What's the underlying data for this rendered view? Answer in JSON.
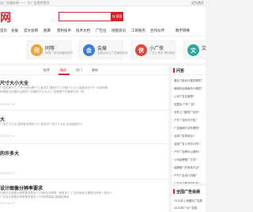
{
  "topbar": {
    "left_text": "告广告服务网 —— 为广告提供策划",
    "right_text": "设为首页"
  },
  "header": {
    "logo_text": "网",
    "search_button_label": "搜索"
  },
  "nav": {
    "items": [
      "首页",
      "会展",
      "官文会网",
      "图库",
      "营利技术",
      "技术文档",
      "广告位",
      "地图资讯",
      "工商税务",
      "合作伙伴",
      "数字转换"
    ]
  },
  "banner": {
    "cards": [
      {
        "icon": "同",
        "title": "同等",
        "sub": "网络广告与传播的热烈",
        "color": "#e9a33a"
      },
      {
        "icon": "会",
        "title": "会展",
        "sub": "会展活动与广告营销实践",
        "color": "#3a7bd5"
      },
      {
        "icon": "侠",
        "title": "小广侠",
        "sub": "广告小帮手 帮你搞定",
        "color": "#e0443a"
      },
      {
        "icon": "文",
        "title": "文",
        "sub": "",
        "color": "#2fa6a0"
      }
    ]
  },
  "tabs": [
    "推荐",
    "精选",
    "热门",
    "最新"
  ],
  "articles": [
    {
      "title": "尺寸大小大全",
      "desc": "广告标牌尺寸,户外大型标牌尺寸,宣传栏,展板尺寸,灯箱尺寸大小,画面设计尺寸,标准规格",
      "desc2": "标牌展示的展示出现的广告牌的尺寸大小,广告牌是户外最常见的一种",
      "meta": "2024-04-16"
    },
    {
      "title": "大",
      "desc": "广告尺寸大全,各种宣传物料尺寸,常见的广告尺寸大全,包括画面尺寸",
      "desc2": "",
      "meta": "2024-04-15"
    },
    {
      "title": "的许多大",
      "desc": "",
      "desc2": "",
      "meta": "2024-04-14"
    },
    {
      "title": "设计图像分辨率要求",
      "desc": "印刷设计图像分辨率要求是多少,印刷品分辨率一般是多少,广告印刷设计图像分辨率一般多少",
      "desc2": "广告设计图像分辨率要求是多少?分辨率越高,图像越清晰",
      "meta": "2024-04-13"
    }
  ],
  "side": {
    "heading": "问答",
    "questions": [
      "展会门面设计做到哪些?",
      "墙面彩绘墙面怎么做呢?",
      "公司广告位管理?",
      "加盟店,户外广告?",
      "怎样上门服务广告的?",
      "户外广告的可行性?",
      "广告营销方法有哪些?",
      "全球广告商排名?",
      "店面广告公司怎么样?",
      "户外广告牌可以做吗?",
      "公司品牌推广方法?",
      "品牌推广的有效方法?",
      "户外广告设计流程?",
      "广告设计做好的标准?",
      "广告公司设计?",
      "户外广告设计方案?"
    ]
  },
  "side2": {
    "heading": "全国广告会展",
    "items": [
      "2024年上海国际广告展",
      "2024年广州广告展"
    ]
  }
}
